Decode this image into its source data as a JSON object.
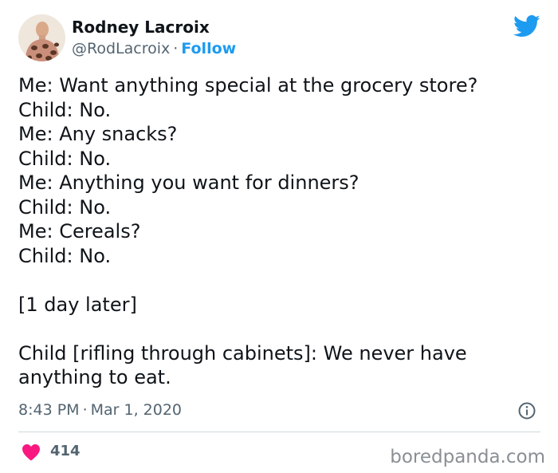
{
  "author": {
    "name": "Rodney Lacroix",
    "handle": "@RodLacroix",
    "separator": "·",
    "follow_label": "Follow"
  },
  "tweet": {
    "lines": [
      "Me: Want anything special at the grocery store?",
      "Child: No.",
      "Me: Any snacks?",
      "Child: No.",
      "Me: Anything you want for dinners?",
      "Child: No.",
      "Me: Cereals?",
      "Child: No.",
      "",
      "[1 day later]",
      "",
      "Child [rifling through cabinets]: We never have",
      "anything to eat."
    ],
    "time": "8:43 PM",
    "separator": "·",
    "date": "Mar 1, 2020"
  },
  "engagement": {
    "like_count": "414"
  },
  "watermark": "boredpanda.com",
  "colors": {
    "twitter_blue": "#1d9bf0",
    "heart_red": "#f91880",
    "text_primary": "#0f1419",
    "text_secondary": "#536471"
  },
  "icons": {
    "brand": "twitter-bird-icon",
    "info": "info-icon",
    "like": "heart-icon"
  }
}
